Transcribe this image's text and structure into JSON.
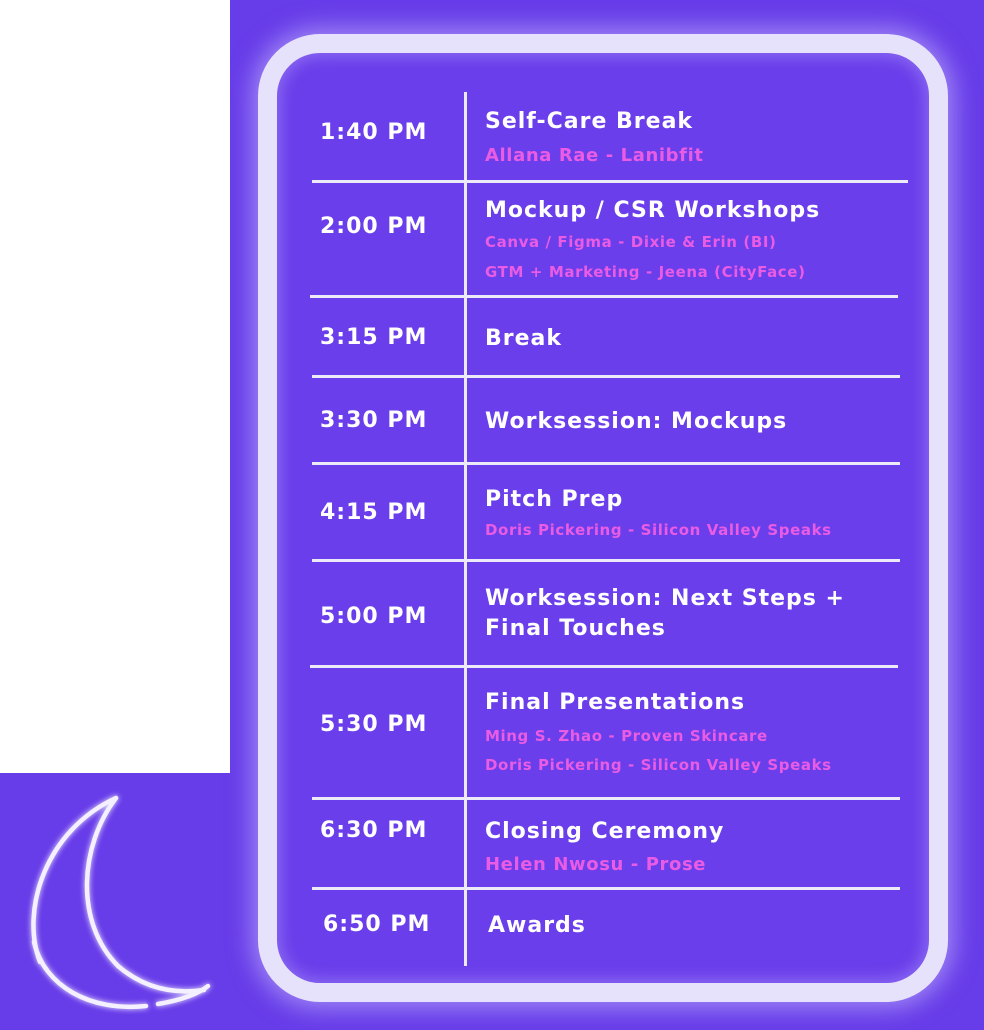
{
  "colors": {
    "background_purple": "#673ce9",
    "frame_border": "#e6e2fb",
    "text_white": "#ffffff",
    "speaker_pink": "#ea5ce3"
  },
  "decoration": {
    "moon_icon": "crescent-moon-neon-outline"
  },
  "schedule": [
    {
      "time": "1:40 PM",
      "title": "Self-Care Break",
      "speakers": [
        "Allana Rae - Lanibfit"
      ]
    },
    {
      "time": "2:00 PM",
      "title": "Mockup / CSR Workshops",
      "speakers": [
        "Canva / Figma - Dixie & Erin (BI)",
        "GTM + Marketing - Jeena (CityFace)"
      ]
    },
    {
      "time": "3:15 PM",
      "title": "Break",
      "speakers": []
    },
    {
      "time": "3:30 PM",
      "title": "Worksession: Mockups",
      "speakers": []
    },
    {
      "time": "4:15 PM",
      "title": "Pitch Prep",
      "speakers": [
        "Doris Pickering - Silicon Valley Speaks"
      ]
    },
    {
      "time": "5:00 PM",
      "title_lines": [
        "Worksession: Next Steps +",
        "Final Touches"
      ],
      "speakers": []
    },
    {
      "time": "5:30 PM",
      "title": "Final Presentations",
      "speakers": [
        "Ming S. Zhao - Proven Skincare",
        "Doris Pickering - Silicon Valley Speaks"
      ]
    },
    {
      "time": "6:30 PM",
      "title": "Closing Ceremony",
      "speakers": [
        "Helen Nwosu - Prose"
      ]
    },
    {
      "time": "6:50 PM",
      "title": "Awards",
      "speakers": []
    }
  ]
}
